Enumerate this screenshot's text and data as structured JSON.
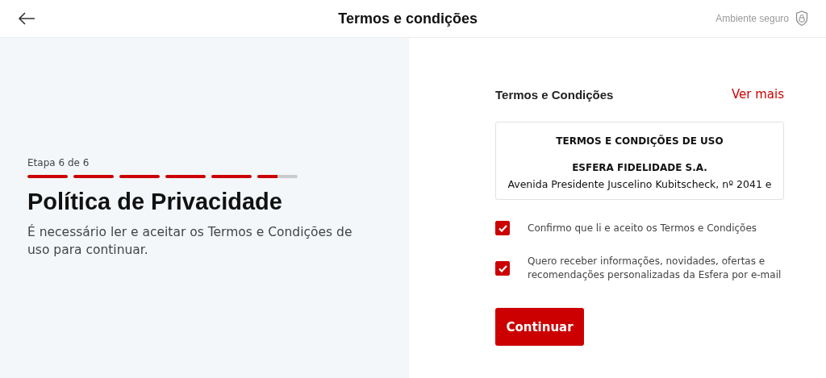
{
  "header": {
    "title": "Termos e condições",
    "secure_label": "Ambiente seguro"
  },
  "step": {
    "label": "Etapa 6 de 6",
    "segments": [
      {
        "level": 1
      },
      {
        "level": 1
      },
      {
        "level": 1
      },
      {
        "level": 1
      },
      {
        "level": 1
      },
      {
        "level": 0.5
      }
    ]
  },
  "intro": {
    "title": "Política de Privacidade",
    "text": "É necessário ler e aceitar os Termos e Condições de uso para continuar."
  },
  "terms": {
    "heading": "Termos e Condições",
    "more_link": "Ver mais",
    "document": {
      "title": "TERMOS E CONDIÇÕES DE USO",
      "company": "ESFERA FIDELIDADE S.A.",
      "address": "Avenida Presidente Juscelino Kubitscheck, nº 2041 e"
    }
  },
  "checkboxes": [
    {
      "label": "Confirmo que li e aceito os Termos e Condições",
      "checked": true
    },
    {
      "label": "Quero receber informações, novidades, ofertas e recomendações personalizadas da Esfera por e-mail",
      "checked": true
    }
  ],
  "buttons": [
    {
      "label": "Continuar"
    }
  ]
}
